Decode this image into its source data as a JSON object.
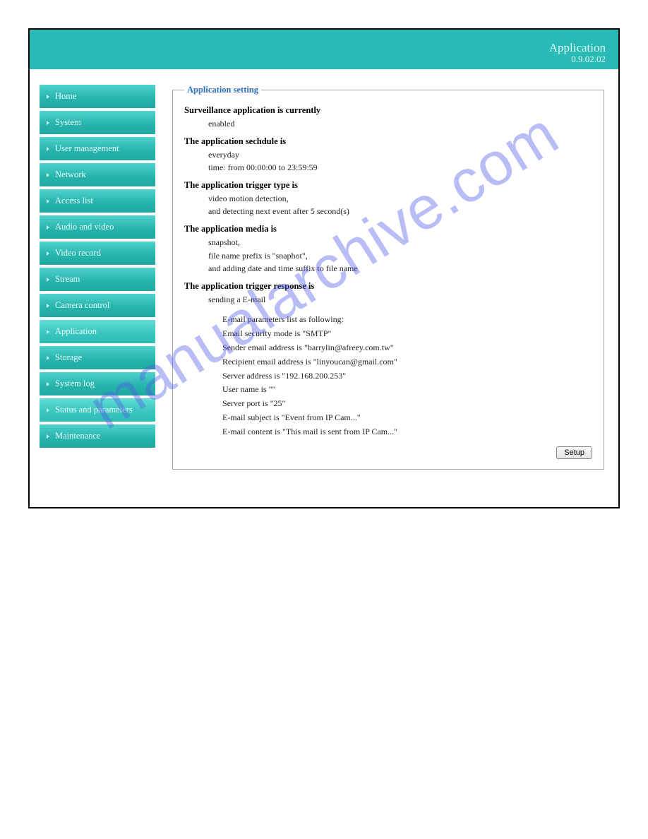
{
  "header": {
    "title": "Application",
    "version": "0.9.02.02"
  },
  "watermark": "manualarchive.com",
  "sidebar": {
    "items": [
      {
        "label": "Home"
      },
      {
        "label": "System"
      },
      {
        "label": "User management"
      },
      {
        "label": "Network"
      },
      {
        "label": "Access list"
      },
      {
        "label": "Audio and video"
      },
      {
        "label": "Video record"
      },
      {
        "label": "Stream"
      },
      {
        "label": "Camera control"
      },
      {
        "label": "Application"
      },
      {
        "label": "Storage"
      },
      {
        "label": "System log"
      },
      {
        "label": "Status and parameters"
      },
      {
        "label": "Maintenance"
      }
    ]
  },
  "panel": {
    "legend": "Application setting",
    "groups": {
      "status": {
        "title": "Surveillance application is currently",
        "lines": [
          "enabled"
        ]
      },
      "schedule": {
        "title": "The application sechdule is",
        "lines": [
          "everyday",
          "time: from 00:00:00 to 23:59:59"
        ]
      },
      "trigger": {
        "title": "The application trigger type is",
        "lines": [
          "video motion detection,",
          "and detecting next event after 5 second(s)"
        ]
      },
      "media": {
        "title": "The application media is",
        "lines": [
          "snapshot,",
          "file name prefix is \"snaphot\",",
          "and adding date and time suffix to file name"
        ]
      },
      "response": {
        "title": "The application trigger response is",
        "lines": [
          "sending a E-mail"
        ],
        "sub": [
          "E-mail parameters list as following:",
          "Email security mode is \"SMTP\"",
          "Sender email address is \"barrylin@afreey.com.tw\"",
          "Recipient email address is \"linyoucan@gmail.com\"",
          "Server address is \"192.168.200.253\"",
          "User name is \"\"",
          "Server port is \"25\"",
          "E-mail subject is \"Event from IP Cam...\"",
          "E-mail content is \"This mail is sent from IP Cam...\""
        ]
      }
    },
    "setup_label": "Setup"
  }
}
